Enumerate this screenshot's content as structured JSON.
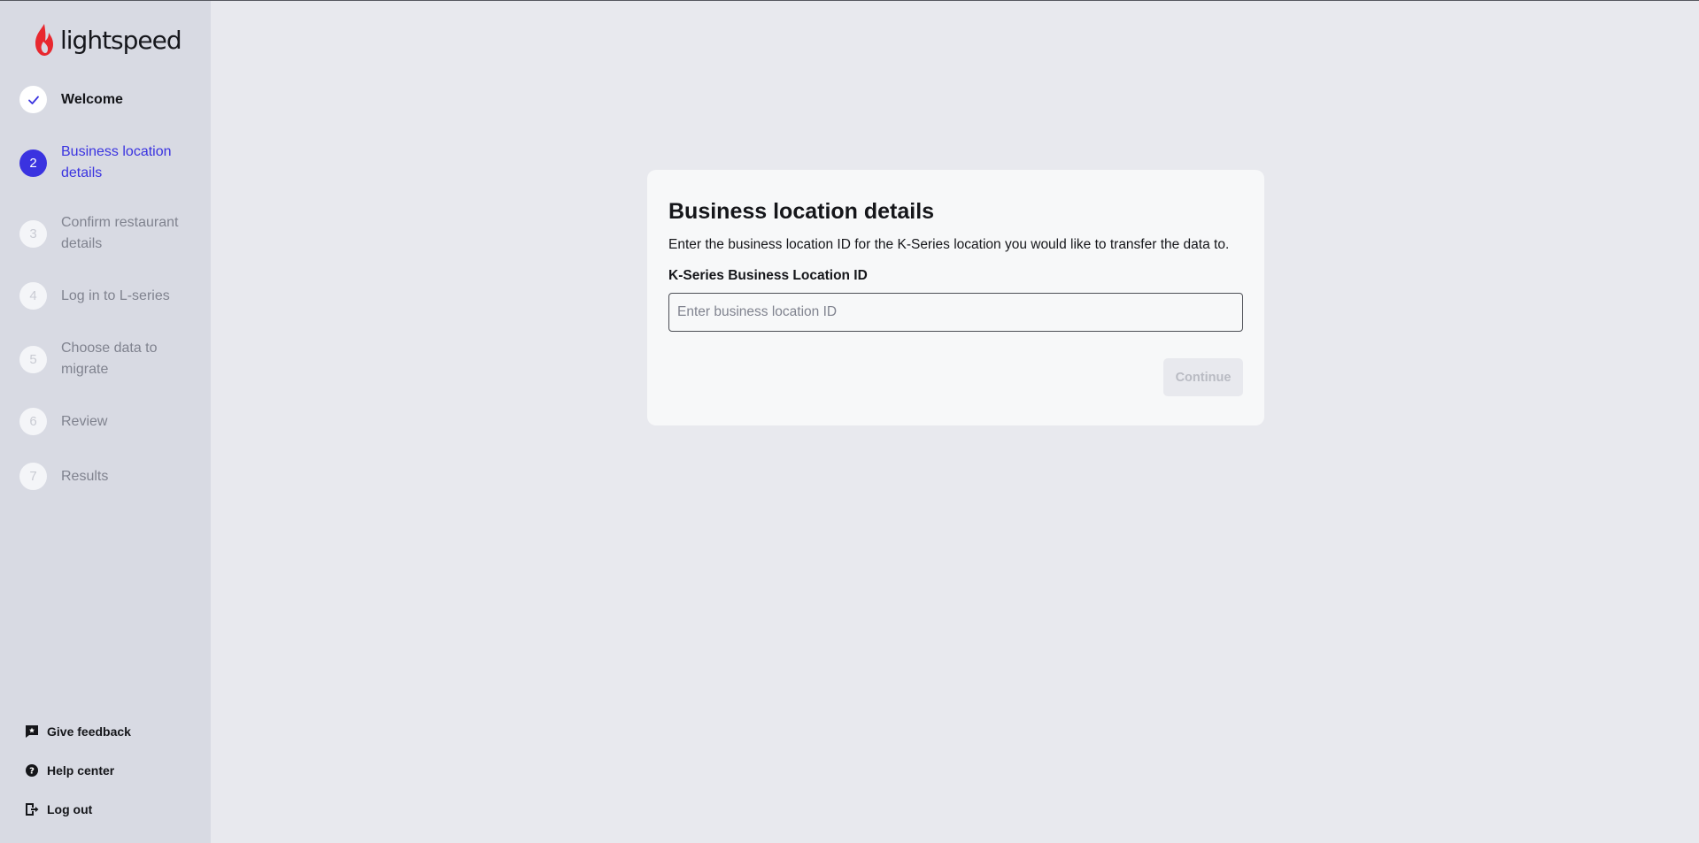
{
  "brand": {
    "name": "lightspeed",
    "color": "#e8282f"
  },
  "steps": [
    {
      "number": "",
      "label": "Welcome",
      "state": "done"
    },
    {
      "number": "2",
      "label": "Business location details",
      "state": "active"
    },
    {
      "number": "3",
      "label": "Confirm restaurant details",
      "state": "pending"
    },
    {
      "number": "4",
      "label": "Log in to L-series",
      "state": "pending"
    },
    {
      "number": "5",
      "label": "Choose data to migrate",
      "state": "pending"
    },
    {
      "number": "6",
      "label": "Review",
      "state": "pending"
    },
    {
      "number": "7",
      "label": "Results",
      "state": "pending"
    }
  ],
  "footer_links": {
    "feedback": "Give feedback",
    "help": "Help center",
    "logout": "Log out"
  },
  "card": {
    "title": "Business location details",
    "description": "Enter the business location ID for the K-Series location you would like to transfer the data to.",
    "field_label": "K-Series Business Location ID",
    "field_placeholder": "Enter business location ID",
    "field_value": "",
    "continue_label": "Continue"
  },
  "colors": {
    "accent": "#3a33e0",
    "sidebar": "#d8dae3",
    "background": "#e8e9ee"
  }
}
